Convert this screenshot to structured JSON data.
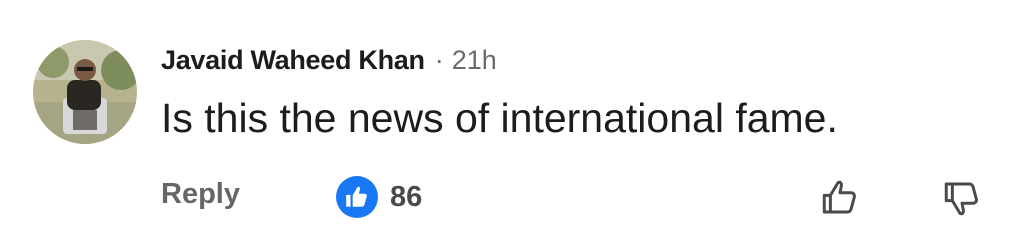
{
  "comment": {
    "author": "Javaid Waheed Khan",
    "separator": "·",
    "time": "21h",
    "text": "Is this the news of international fame.",
    "reply_label": "Reply",
    "like_count": "86"
  },
  "icons": {
    "reaction": "like-thumb-icon",
    "upvote": "thumb-up-outline-icon",
    "downvote": "thumb-down-outline-icon"
  },
  "colors": {
    "like_badge": "#1877f2",
    "text_primary": "#1c1c1c",
    "text_secondary": "#666666"
  }
}
